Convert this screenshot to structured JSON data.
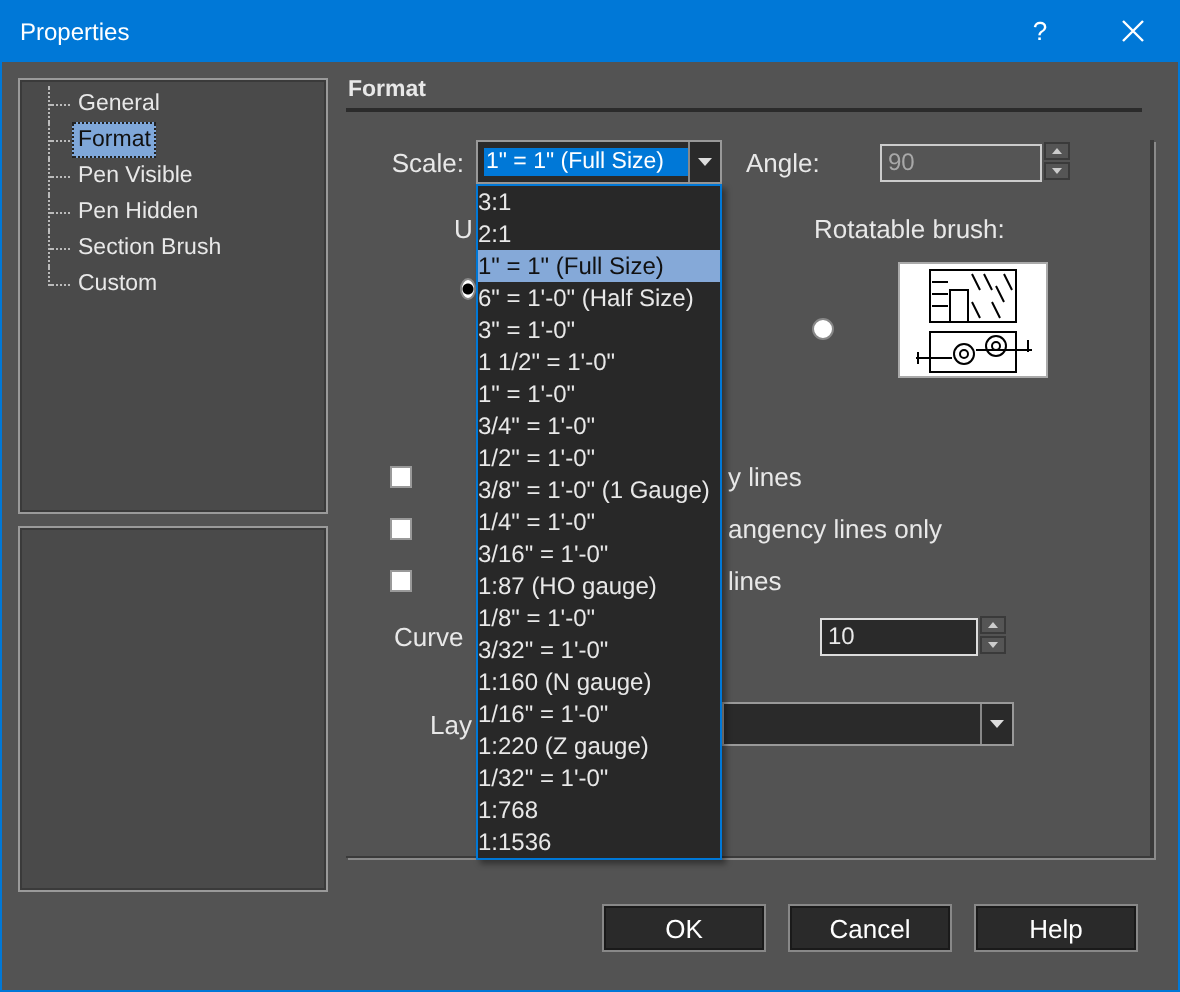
{
  "window": {
    "title": "Properties",
    "help": "?"
  },
  "tree": [
    {
      "label": "General",
      "selected": false
    },
    {
      "label": "Format",
      "selected": true
    },
    {
      "label": "Pen Visible",
      "selected": false
    },
    {
      "label": "Pen Hidden",
      "selected": false
    },
    {
      "label": "Section Brush",
      "selected": false
    },
    {
      "label": "Custom",
      "selected": false
    }
  ],
  "section_title": "Format",
  "scale": {
    "label": "Scale:",
    "value": "1\" = 1\" (Full Size)",
    "options": [
      {
        "label": "3:1",
        "selected": false
      },
      {
        "label": "2:1",
        "selected": false
      },
      {
        "label": "1\" = 1\" (Full Size)",
        "selected": true
      },
      {
        "label": "6\" = 1'-0\" (Half Size)",
        "selected": false
      },
      {
        "label": "3\" = 1'-0\"",
        "selected": false
      },
      {
        "label": "1 1/2\" = 1'-0\"",
        "selected": false
      },
      {
        "label": "1\" = 1'-0\"",
        "selected": false
      },
      {
        "label": "3/4\" = 1'-0\"",
        "selected": false
      },
      {
        "label": "1/2\" = 1'-0\"",
        "selected": false
      },
      {
        "label": "3/8\" = 1'-0\" (1 Gauge)",
        "selected": false
      },
      {
        "label": "1/4\" = 1'-0\"",
        "selected": false
      },
      {
        "label": "3/16\" = 1'-0\"",
        "selected": false
      },
      {
        "label": "1:87 (HO gauge)",
        "selected": false
      },
      {
        "label": "1/8\" = 1'-0\"",
        "selected": false
      },
      {
        "label": "3/32\" = 1'-0\"",
        "selected": false
      },
      {
        "label": "1:160 (N gauge)",
        "selected": false
      },
      {
        "label": "1/16\" = 1'-0\"",
        "selected": false
      },
      {
        "label": "1:220 (Z gauge)",
        "selected": false
      },
      {
        "label": "1/32\" = 1'-0\"",
        "selected": false
      },
      {
        "label": "1:768",
        "selected": false
      },
      {
        "label": "1:1536",
        "selected": false
      }
    ]
  },
  "angle": {
    "label": "Angle:",
    "value": "90",
    "disabled": true
  },
  "u_label": "U",
  "rotatable_label": "Rotatable brush:",
  "radios": [
    {
      "selected": true
    },
    {
      "selected": false
    }
  ],
  "checkboxes": [
    {
      "label": "y lines",
      "checked": false
    },
    {
      "label": "angency lines only",
      "checked": false
    },
    {
      "label": "lines",
      "checked": false
    }
  ],
  "curve": {
    "label": "Curve",
    "value": "10"
  },
  "layer": {
    "label": "Lay"
  },
  "buttons": [
    "OK",
    "Cancel",
    "Help"
  ]
}
